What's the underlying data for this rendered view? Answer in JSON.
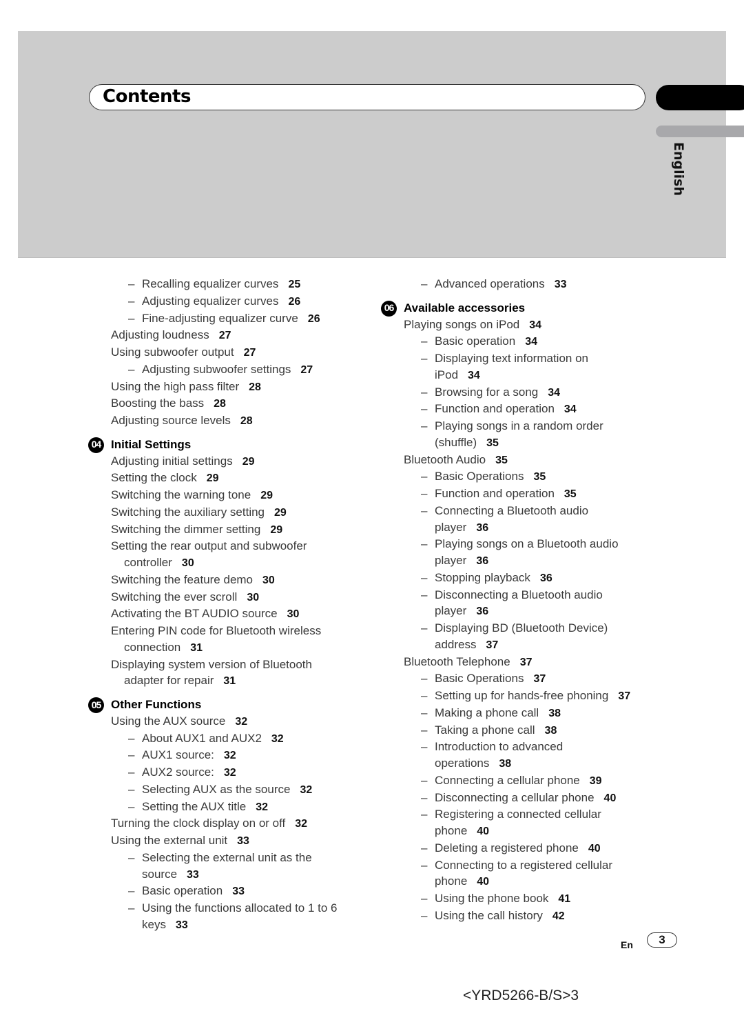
{
  "header": {
    "title": "Contents",
    "language_tab": "English"
  },
  "toc": {
    "left": [
      {
        "type": "sub",
        "text": "Recalling equalizer curves",
        "page": "25"
      },
      {
        "type": "sub",
        "text": "Adjusting equalizer curves",
        "page": "26"
      },
      {
        "type": "sub",
        "text": "Fine-adjusting equalizer curve",
        "page": "26"
      },
      {
        "type": "item",
        "text": "Adjusting loudness",
        "page": "27"
      },
      {
        "type": "item",
        "text": "Using subwoofer output",
        "page": "27"
      },
      {
        "type": "sub",
        "text": "Adjusting subwoofer settings",
        "page": "27"
      },
      {
        "type": "item",
        "text": "Using the high pass filter",
        "page": "28"
      },
      {
        "type": "item",
        "text": "Boosting the bass",
        "page": "28"
      },
      {
        "type": "item",
        "text": "Adjusting source levels",
        "page": "28"
      },
      {
        "type": "section",
        "number": "04",
        "text": "Initial Settings"
      },
      {
        "type": "item",
        "text": "Adjusting initial settings",
        "page": "29"
      },
      {
        "type": "item",
        "text": "Setting the clock",
        "page": "29"
      },
      {
        "type": "item",
        "text": "Switching the warning tone",
        "page": "29"
      },
      {
        "type": "item",
        "text": "Switching the auxiliary setting",
        "page": "29"
      },
      {
        "type": "item",
        "text": "Switching the dimmer setting",
        "page": "29"
      },
      {
        "type": "item",
        "text": "Setting the rear output and subwoofer",
        "cont": "controller",
        "page": "30"
      },
      {
        "type": "item",
        "text": "Switching the feature demo",
        "page": "30"
      },
      {
        "type": "item",
        "text": "Switching the ever scroll",
        "page": "30"
      },
      {
        "type": "item",
        "text": "Activating the BT AUDIO source",
        "page": "30"
      },
      {
        "type": "item",
        "text": "Entering PIN code for Bluetooth wireless",
        "cont": "connection",
        "page": "31"
      },
      {
        "type": "item",
        "text": "Displaying system version of Bluetooth",
        "cont": "adapter for repair",
        "page": "31"
      },
      {
        "type": "section",
        "number": "05",
        "text": "Other Functions"
      },
      {
        "type": "item",
        "text": "Using the AUX source",
        "page": "32"
      },
      {
        "type": "sub",
        "text": "About AUX1 and AUX2",
        "page": "32"
      },
      {
        "type": "sub",
        "text": "AUX1 source:",
        "page": "32"
      },
      {
        "type": "sub",
        "text": "AUX2 source:",
        "page": "32"
      },
      {
        "type": "sub",
        "text": "Selecting AUX as the source",
        "page": "32"
      },
      {
        "type": "sub",
        "text": "Setting the AUX title",
        "page": "32"
      },
      {
        "type": "item",
        "text": "Turning the clock display on or off",
        "page": "32"
      },
      {
        "type": "item",
        "text": "Using the external unit",
        "page": "33"
      },
      {
        "type": "sub",
        "text": "Selecting the external unit as the",
        "cont": "source",
        "page": "33"
      },
      {
        "type": "sub",
        "text": "Basic operation",
        "page": "33"
      },
      {
        "type": "sub",
        "text": "Using the functions allocated to 1 to 6",
        "cont": "keys",
        "page": "33"
      }
    ],
    "right": [
      {
        "type": "sub",
        "text": "Advanced operations",
        "page": "33"
      },
      {
        "type": "section",
        "number": "06",
        "text": "Available accessories"
      },
      {
        "type": "item",
        "text": "Playing songs on iPod",
        "page": "34"
      },
      {
        "type": "sub",
        "text": "Basic operation",
        "page": "34"
      },
      {
        "type": "sub",
        "text": "Displaying text information on",
        "cont": "iPod",
        "page": "34"
      },
      {
        "type": "sub",
        "text": "Browsing for a song",
        "page": "34"
      },
      {
        "type": "sub",
        "text": "Function and operation",
        "page": "34"
      },
      {
        "type": "sub",
        "text": "Playing songs in a random order",
        "cont": "(shuffle)",
        "page": "35"
      },
      {
        "type": "item",
        "text": "Bluetooth Audio",
        "page": "35"
      },
      {
        "type": "sub",
        "text": "Basic Operations",
        "page": "35"
      },
      {
        "type": "sub",
        "text": "Function and operation",
        "page": "35"
      },
      {
        "type": "sub",
        "text": "Connecting a Bluetooth audio",
        "cont": "player",
        "page": "36"
      },
      {
        "type": "sub",
        "text": "Playing songs on a Bluetooth audio",
        "cont": "player",
        "page": "36"
      },
      {
        "type": "sub",
        "text": "Stopping playback",
        "page": "36"
      },
      {
        "type": "sub",
        "text": "Disconnecting a Bluetooth audio",
        "cont": "player",
        "page": "36"
      },
      {
        "type": "sub",
        "text": "Displaying BD (Bluetooth Device)",
        "cont": "address",
        "page": "37"
      },
      {
        "type": "item",
        "text": "Bluetooth Telephone",
        "page": "37"
      },
      {
        "type": "sub",
        "text": "Basic Operations",
        "page": "37"
      },
      {
        "type": "sub",
        "text": "Setting up for hands-free phoning",
        "page": "37"
      },
      {
        "type": "sub",
        "text": "Making a phone call",
        "page": "38"
      },
      {
        "type": "sub",
        "text": "Taking a phone call",
        "page": "38"
      },
      {
        "type": "sub",
        "text": "Introduction to advanced",
        "cont": "operations",
        "page": "38"
      },
      {
        "type": "sub",
        "text": "Connecting a cellular phone",
        "page": "39"
      },
      {
        "type": "sub",
        "text": "Disconnecting a cellular phone",
        "page": "40"
      },
      {
        "type": "sub",
        "text": "Registering a connected cellular",
        "cont": "phone",
        "page": "40"
      },
      {
        "type": "sub",
        "text": "Deleting a registered phone",
        "page": "40"
      },
      {
        "type": "sub",
        "text": "Connecting to a registered cellular",
        "cont": "phone",
        "page": "40"
      },
      {
        "type": "sub",
        "text": "Using the phone book",
        "page": "41"
      },
      {
        "type": "sub",
        "text": "Using the call history",
        "page": "42"
      }
    ]
  },
  "footer": {
    "lang_code": "En",
    "page_number": "3",
    "doc_code": "<YRD5266-B/S>3"
  }
}
